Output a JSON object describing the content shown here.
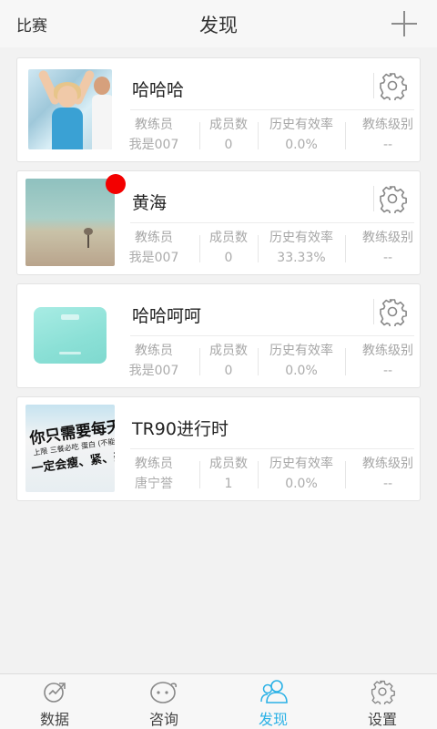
{
  "header": {
    "left_label": "比赛",
    "title": "发现",
    "add_icon": "plus-icon"
  },
  "stat_labels": {
    "coach": "教练员",
    "members": "成员数",
    "efficiency": "历史有效率",
    "level": "教练级别"
  },
  "groups": [
    {
      "name": "哈哈哈",
      "thumb": "fitness-photo",
      "badge": false,
      "coach": "我是007",
      "members": "0",
      "efficiency": "0.0%",
      "level": "--"
    },
    {
      "name": "黄海",
      "thumb": "landscape-photo",
      "badge": true,
      "badge_color": "#f30000",
      "coach": "我是007",
      "members": "0",
      "efficiency": "33.33%",
      "level": "--"
    },
    {
      "name": "哈哈呵呵",
      "thumb": "scale-photo",
      "badge": false,
      "coach": "我是007",
      "members": "0",
      "efficiency": "0.0%",
      "level": "--"
    },
    {
      "name": "TR90进行时",
      "thumb": "poster-photo",
      "badge": false,
      "coach": "唐宁誉",
      "members": "1",
      "efficiency": "0.0%",
      "level": "--",
      "poster_text": {
        "line1": "你只需要每天",
        "line2": "上限 三餐必吃 蛋白 (不能运动)",
        "line3": "一定会瘦、紧、美!"
      }
    }
  ],
  "tabs": [
    {
      "label": "数据",
      "icon": "chart-data-icon",
      "active": false
    },
    {
      "label": "咨询",
      "icon": "chat-face-icon",
      "active": false
    },
    {
      "label": "发现",
      "icon": "people-icon",
      "active": true
    },
    {
      "label": "设置",
      "icon": "gear-icon",
      "active": false
    }
  ],
  "colors": {
    "accent": "#2ab1e6",
    "badge": "#f30000",
    "stat_text": "#a7a7a7"
  }
}
